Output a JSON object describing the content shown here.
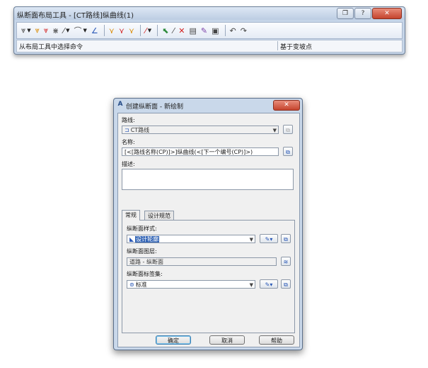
{
  "toolbar": {
    "title": "纵断面布局工具 - [CT路线]纵曲线(1)",
    "window_controls": {
      "restore": "❐",
      "help": "?",
      "close": "✕"
    },
    "buttons": [
      {
        "name": "draw-tangents-button",
        "glyph": "⩔",
        "dropdown": true
      },
      {
        "name": "insert-pvi-button",
        "glyph": "⩔",
        "dropdown": false
      },
      {
        "name": "delete-pvi-button",
        "glyph": "⩔",
        "dropdown": false
      },
      {
        "name": "move-pvi-button",
        "glyph": "⋇",
        "dropdown": false
      },
      {
        "name": "draw-line-button",
        "glyph": "⁄",
        "dropdown": true
      },
      {
        "name": "draw-curve-button",
        "glyph": "⌒",
        "dropdown": true
      },
      {
        "name": "curve-settings-button",
        "glyph": "∠",
        "dropdown": false
      },
      {
        "name": "insert-pvis-button",
        "glyph": "⋎",
        "dropdown": false
      },
      {
        "name": "delete-pvis-button",
        "glyph": "⋎",
        "dropdown": false
      },
      {
        "name": "raise-lower-pvis-button",
        "glyph": "⋎",
        "dropdown": false
      },
      {
        "name": "copy-profile-button",
        "glyph": "⁄",
        "dropdown": true
      },
      {
        "name": "select-pvi-button",
        "glyph": "⬉",
        "dropdown": false
      },
      {
        "name": "delete-entity-button",
        "glyph": "⁄",
        "dropdown": false
      },
      {
        "name": "grid-view-button",
        "glyph": "▤",
        "dropdown": false
      },
      {
        "name": "edit-grid-button",
        "glyph": "✎",
        "dropdown": false
      },
      {
        "name": "profile-properties-button",
        "glyph": "▣",
        "dropdown": false
      },
      {
        "name": "undo-button",
        "glyph": "↶",
        "dropdown": false
      },
      {
        "name": "redo-button",
        "glyph": "↷",
        "dropdown": false
      }
    ],
    "status_left": "从布局工具中选择命令",
    "status_right": "基于变坡点"
  },
  "dialog": {
    "logo": "A",
    "title": "创建纵断面 - 新绘制",
    "close": "✕",
    "alignment_label": "路线:",
    "alignment_value": "CT路线",
    "name_label": "名称:",
    "name_value": "[<[路线名称(CP)]>]纵曲线(<[下一个编号(CP)]>)",
    "description_label": "描述:",
    "description_value": "",
    "tabs": [
      "常规",
      "设计规范"
    ],
    "style_label": "纵断面样式:",
    "style_value": "设计轮廓",
    "layer_label": "纵断面图层:",
    "layer_value": "道路 - 纵断面",
    "labelset_label": "纵断面标签集:",
    "labelset_value": "标准",
    "ok": "确定",
    "cancel": "取消",
    "help": "帮助"
  },
  "colors": {
    "window_frame": "#c6d5e8",
    "close_red": "#c5442e",
    "selection": "#3465b5"
  }
}
